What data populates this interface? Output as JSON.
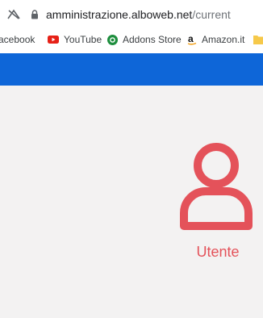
{
  "address_bar": {
    "url_host": "amministrazione.alboweb.net",
    "url_path": "/current"
  },
  "bookmarks": [
    {
      "label": "acebook",
      "icon": "facebook-icon"
    },
    {
      "label": "YouTube",
      "icon": "youtube-icon"
    },
    {
      "label": "Addons Store",
      "icon": "addons-store-icon"
    },
    {
      "label": "Amazon.it",
      "icon": "amazon-icon"
    },
    {
      "label": "",
      "icon": "folder-icon"
    }
  ],
  "colors": {
    "header_blue": "#0e66d8",
    "user_accent": "#e4525a",
    "content_bg": "#f3f2f2"
  },
  "content": {
    "user_label": "Utente",
    "user_icon": "user-icon"
  }
}
